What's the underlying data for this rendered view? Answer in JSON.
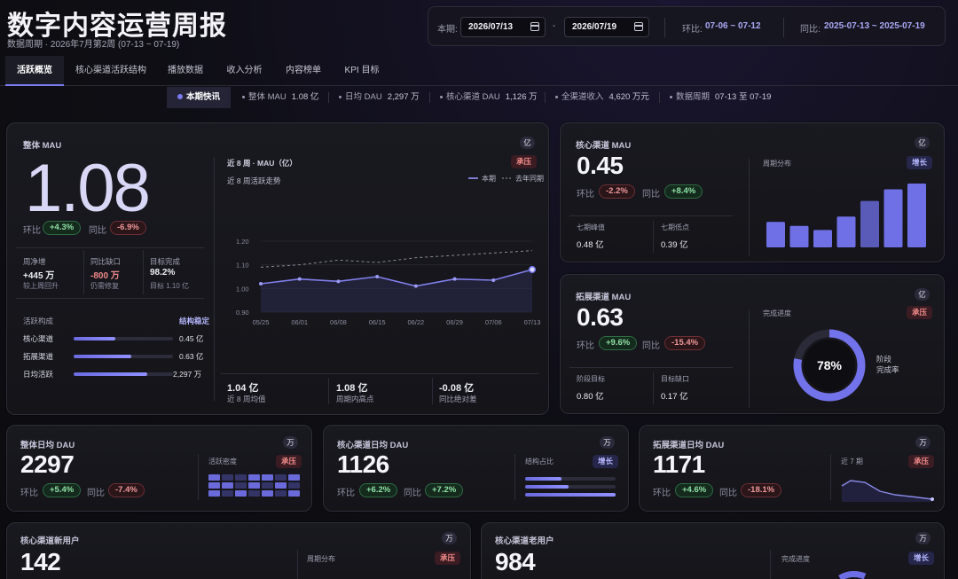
{
  "header": {
    "title": "数字内容运营周报",
    "subtitle": "数据周期 · 2026年7月第2周 (07-13 ~ 07-19)"
  },
  "filters": {
    "period_label": "本期:",
    "start_date": "2026/07/13",
    "dash": "-",
    "end_date": "2026/07/19",
    "mom_label": "环比:",
    "mom_value": "07-06 ~ 07-12",
    "yoy_label": "同比:",
    "yoy_value": "2025-07-13 ~ 2025-07-19"
  },
  "tabs": [
    "活跃概览",
    "核心渠道活跃结构",
    "播放数据",
    "收入分析",
    "内容榜单",
    "KPI 目标"
  ],
  "ticker": {
    "title": "本期快讯",
    "items": [
      {
        "label": "整体 MAU",
        "value": "1.08 亿"
      },
      {
        "label": "日均 DAU",
        "value": "2,297 万"
      },
      {
        "label": "核心渠道 DAU",
        "value": "1,126 万"
      },
      {
        "label": "全渠道收入",
        "value": "4,620 万元"
      },
      {
        "label": "数据周期",
        "value": "07-13 至 07-19"
      }
    ]
  },
  "main_card": {
    "title": "整体 MAU",
    "unit": "亿",
    "value": "1.08",
    "mom_label": "环比",
    "mom": "+4.3%",
    "yoy_label": "同比",
    "yoy": "-6.9%",
    "stats": [
      {
        "label": "周净增",
        "value": "+445 万",
        "sub": "较上周回升"
      },
      {
        "label": "同比缺口",
        "value": "-800 万",
        "sub": "仍需修复"
      },
      {
        "label": "目标完成",
        "value": "98.2%",
        "sub": "目标 1.10 亿"
      }
    ],
    "struct_title": "活跃构成",
    "struct_tag": "结构稳定",
    "struct": [
      {
        "label": "核心渠道",
        "value": "0.45 亿",
        "pct": 0.42
      },
      {
        "label": "拓展渠道",
        "value": "0.63 亿",
        "pct": 0.58
      },
      {
        "label": "日均活跃",
        "value": "2,297 万",
        "pct": 0.74
      }
    ],
    "chart_head": "近 8 周 · MAU（亿）",
    "chart_tag": "承压",
    "chart_sub": "近 8 周活跃走势",
    "footer": [
      {
        "value": "1.04 亿",
        "label": "近 8 周均值"
      },
      {
        "value": "1.08 亿",
        "label": "周期内高点"
      },
      {
        "value": "-0.08 亿",
        "label": "同比绝对差"
      }
    ]
  },
  "chart_data": {
    "type": "line",
    "x": [
      "05/25",
      "06/01",
      "06/08",
      "06/15",
      "06/22",
      "06/29",
      "07/06",
      "07/13"
    ],
    "series": [
      {
        "name": "本期",
        "values": [
          1.02,
          1.04,
          1.03,
          1.05,
          1.01,
          1.04,
          1.035,
          1.08
        ]
      },
      {
        "name": "去年同期",
        "values": [
          1.09,
          1.1,
          1.12,
          1.11,
          1.13,
          1.14,
          1.15,
          1.16
        ]
      }
    ],
    "yticks": [
      "1.20",
      "1.10",
      "1.00",
      "0.90"
    ],
    "ylim": [
      0.9,
      1.2
    ],
    "grid": true,
    "legend": "top-right"
  },
  "core_mau": {
    "title": "核心渠道 MAU",
    "unit": "亿",
    "value": "0.45",
    "mom_label": "环比",
    "mom": "-2.2%",
    "yoy_label": "同比",
    "yoy": "+8.4%",
    "peak_label": "七期峰值",
    "peak": "0.48 亿",
    "low_label": "七期低点",
    "low": "0.39 亿",
    "dist_label": "周期分布",
    "dist_tag": "增长",
    "bars": [
      0.44,
      0.37,
      0.3,
      0.53,
      0.8,
      1.0,
      1.1
    ]
  },
  "ext_mau": {
    "title": "拓展渠道 MAU",
    "unit": "亿",
    "value": "0.63",
    "mom_label": "环比",
    "mom": "+9.6%",
    "yoy_label": "同比",
    "yoy": "-15.4%",
    "target_label": "阶段目标",
    "target": "0.80 亿",
    "gap_label": "目标缺口",
    "gap": "0.17 亿",
    "prog_label": "完成进度",
    "prog_tag": "承压",
    "ring_value": "78%",
    "ring_pct": 0.78,
    "ring_caption": "阶段\n完成率"
  },
  "dau_total": {
    "title": "整体日均 DAU",
    "unit": "万",
    "value": "2297",
    "mom_label": "环比",
    "mom": "+5.4%",
    "yoy_label": "同比",
    "yoy": "-7.4%",
    "side_label": "活跃密度",
    "side_tag": "承压"
  },
  "dau_core": {
    "title": "核心渠道日均 DAU",
    "unit": "万",
    "value": "1126",
    "mom_label": "环比",
    "mom": "+6.2%",
    "yoy_label": "同比",
    "yoy": "+7.2%",
    "side_label": "结构占比",
    "side_tag": "增长",
    "bars": [
      0.4,
      0.48,
      1.0
    ]
  },
  "dau_ext": {
    "title": "拓展渠道日均 DAU",
    "unit": "万",
    "value": "1171",
    "mom_label": "环比",
    "mom": "+4.6%",
    "yoy_label": "同比",
    "yoy": "-18.1%",
    "side_label": "近 7 期",
    "side_tag": "承压"
  },
  "core_new": {
    "title": "核心渠道新用户",
    "unit": "万",
    "value": "142",
    "side_label": "周期分布",
    "side_tag": "承压"
  },
  "core_old": {
    "title": "核心渠道老用户",
    "unit": "万",
    "value": "984",
    "side_label": "完成进度",
    "side_tag": "增长"
  }
}
